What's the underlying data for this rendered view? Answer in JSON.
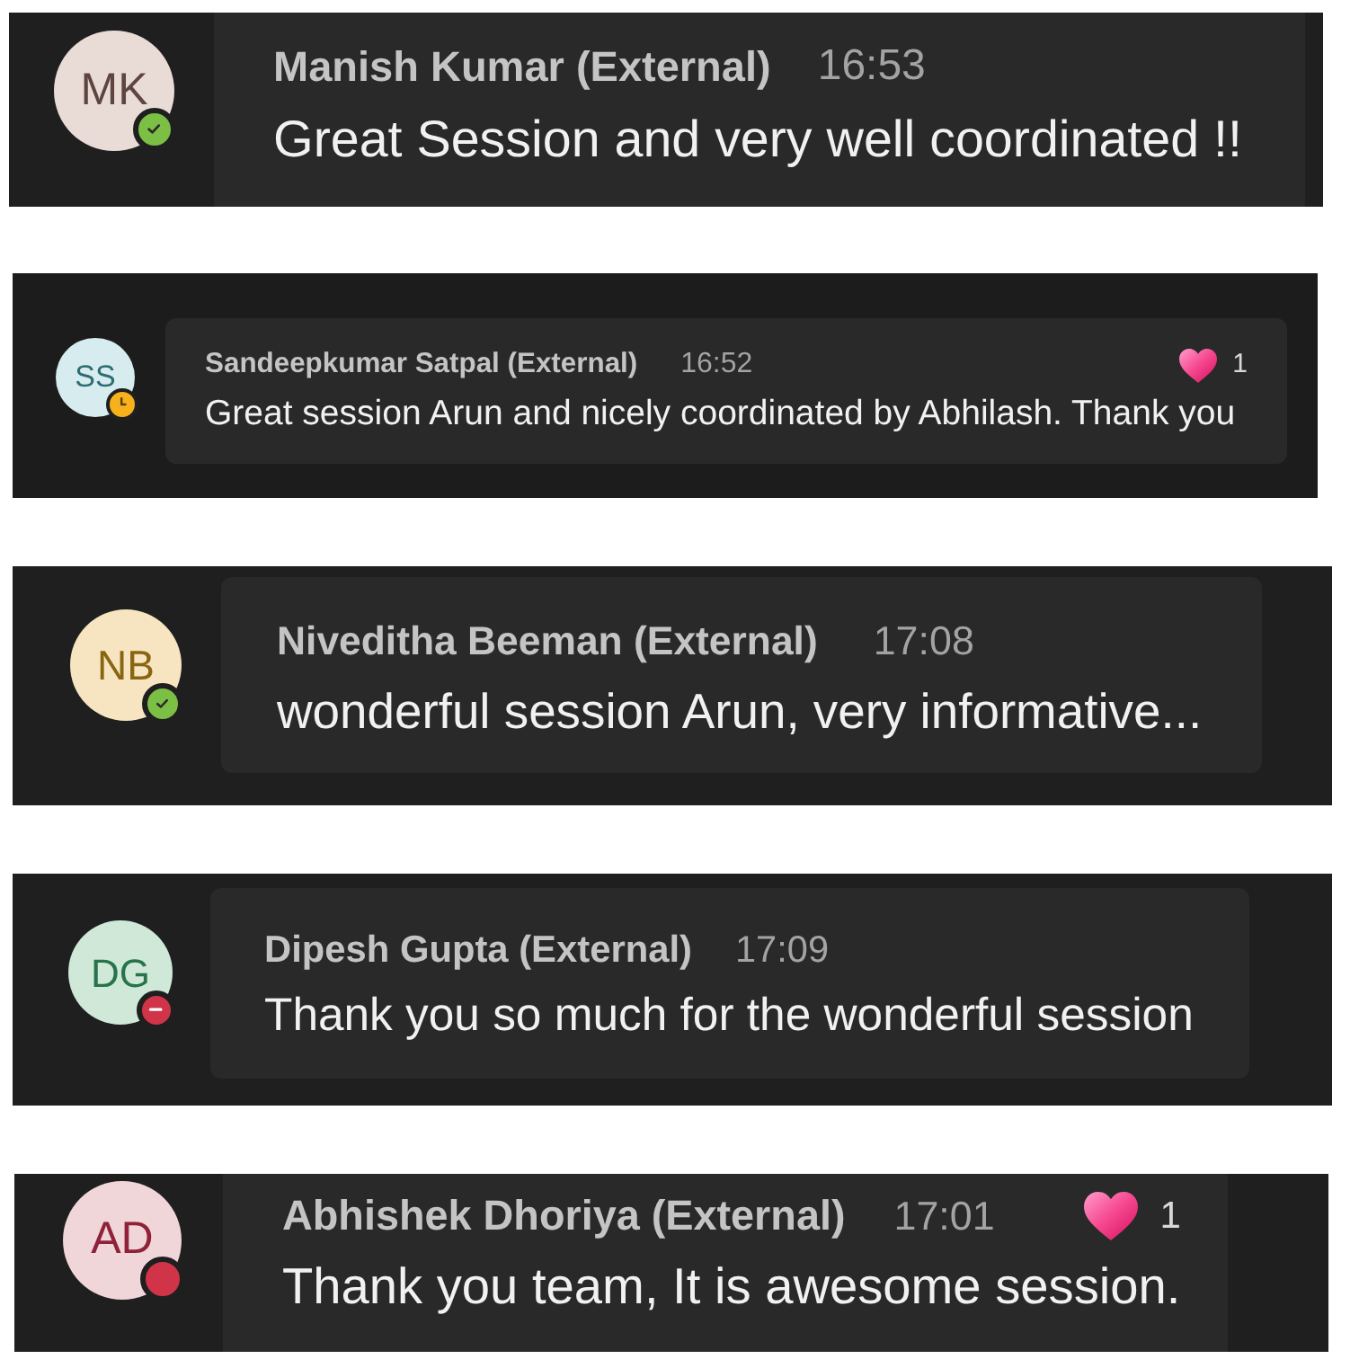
{
  "messages": [
    {
      "avatar": {
        "initials": "MK",
        "color": "#e9dcd7"
      },
      "status_badge": {
        "kind": "available"
      },
      "sender": "Manish Kumar (External)",
      "time": "16:53",
      "text": "Great Session and very well coordinated !!"
    },
    {
      "avatar": {
        "initials": "SS",
        "color": "#d6ecef"
      },
      "status_badge": {
        "kind": "away"
      },
      "sender": "Sandeepkumar Satpal (External)",
      "time": "16:52",
      "text": "Great session Arun and nicely coordinated by Abhilash. Thank you",
      "reaction": {
        "count": "1"
      }
    },
    {
      "avatar": {
        "initials": "NB",
        "color": "#f6e5c0"
      },
      "status_badge": {
        "kind": "available"
      },
      "sender": "Niveditha Beeman (External)",
      "time": "17:08",
      "text": "wonderful session Arun, very informative..."
    },
    {
      "avatar": {
        "initials": "DG",
        "color": "#cfe8d7"
      },
      "status_badge": {
        "kind": "do_not_disturb"
      },
      "sender": "Dipesh Gupta (External)",
      "time": "17:09",
      "text": "Thank you so much for the wonderful session"
    },
    {
      "avatar": {
        "initials": "AD",
        "color": "#f0d5d9"
      },
      "status_badge": {
        "kind": "busy"
      },
      "sender": "Abhishek Dhoriya (External)",
      "time": "17:01",
      "text": "Thank you team, It is awesome session.",
      "reaction": {
        "count": "1"
      }
    }
  ]
}
